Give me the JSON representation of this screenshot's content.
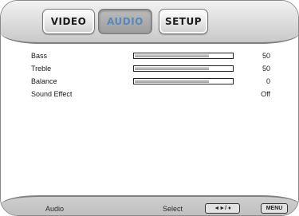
{
  "tabs": [
    {
      "label": "VIDEO",
      "active": false
    },
    {
      "label": "AUDIO",
      "active": true
    },
    {
      "label": "SETUP",
      "active": false
    }
  ],
  "settings": [
    {
      "label": "Bass",
      "value": "50",
      "level_percent": 50
    },
    {
      "label": "Treble",
      "value": "50",
      "level_percent": 50
    },
    {
      "label": "Balance",
      "value": "0",
      "level_percent": 50
    },
    {
      "label": "Sound Effect",
      "value": "Off"
    }
  ],
  "footer": {
    "section": "Audio",
    "select_hint": "Select",
    "nav_keys": "◄►/ ♦",
    "menu_key": "MENU"
  },
  "colors": {
    "active_tab_text": "#5a88b8",
    "bar_fill": "#b0b0b0"
  }
}
